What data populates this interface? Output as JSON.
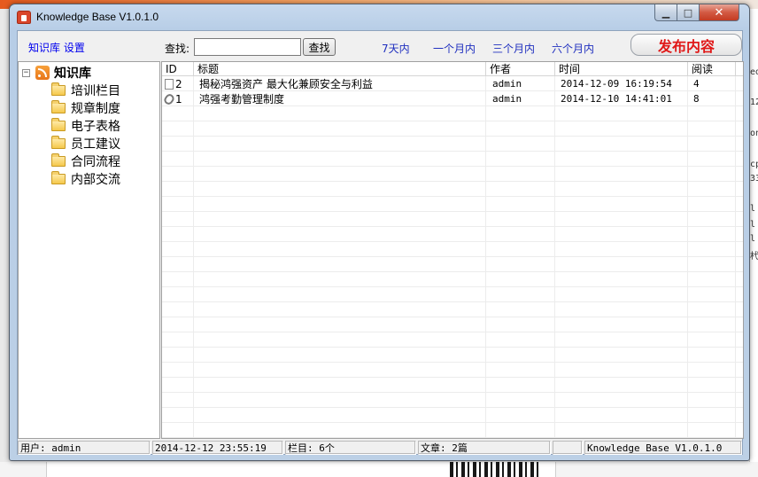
{
  "window": {
    "title": "Knowledge Base V1.0.1.0",
    "minimize_glyph": "▁",
    "maximize_glyph": "□",
    "close_glyph": "✕"
  },
  "toolbar": {
    "settings_link": "知识库 设置",
    "search_label": "查找:",
    "search_value": "",
    "search_button": "查找",
    "ranges": [
      "7天内",
      "一个月内",
      "三个月内",
      "六个月内"
    ],
    "publish_button": "发布内容"
  },
  "tree": {
    "root_label": "知识库",
    "expander": "−",
    "items": [
      "培训栏目",
      "规章制度",
      "电子表格",
      "员工建议",
      "合同流程",
      "内部交流"
    ]
  },
  "grid": {
    "columns": [
      "ID",
      "标题",
      "作者",
      "时间",
      "阅读"
    ],
    "rows": [
      {
        "icon": "document-icon",
        "id": "2",
        "title": "揭秘鸿强资产 最大化兼顾安全与利益",
        "author": "admin",
        "time": "2014-12-09 16:19:54",
        "reads": "4"
      },
      {
        "icon": "attachment-icon",
        "id": "1",
        "title": "鸿强考勤管理制度",
        "author": "admin",
        "time": "2014-12-10 14:41:01",
        "reads": "8"
      }
    ]
  },
  "statusbar": {
    "user": "用户: admin",
    "datetime": "2014-12-12 23:55:19",
    "columns_count": "栏目: 6个",
    "articles_count": "文章: 2篇",
    "empty": "",
    "version": "Knowledge Base V1.0.1.0"
  },
  "background": {
    "right_edge_text": [
      "ed",
      "12",
      "on",
      "cp",
      "33",
      "l",
      "l",
      "l",
      "杙"
    ]
  },
  "colors": {
    "publish_text": "#e01818",
    "link": "#1f2fbf",
    "close_button": "#c43b22"
  }
}
